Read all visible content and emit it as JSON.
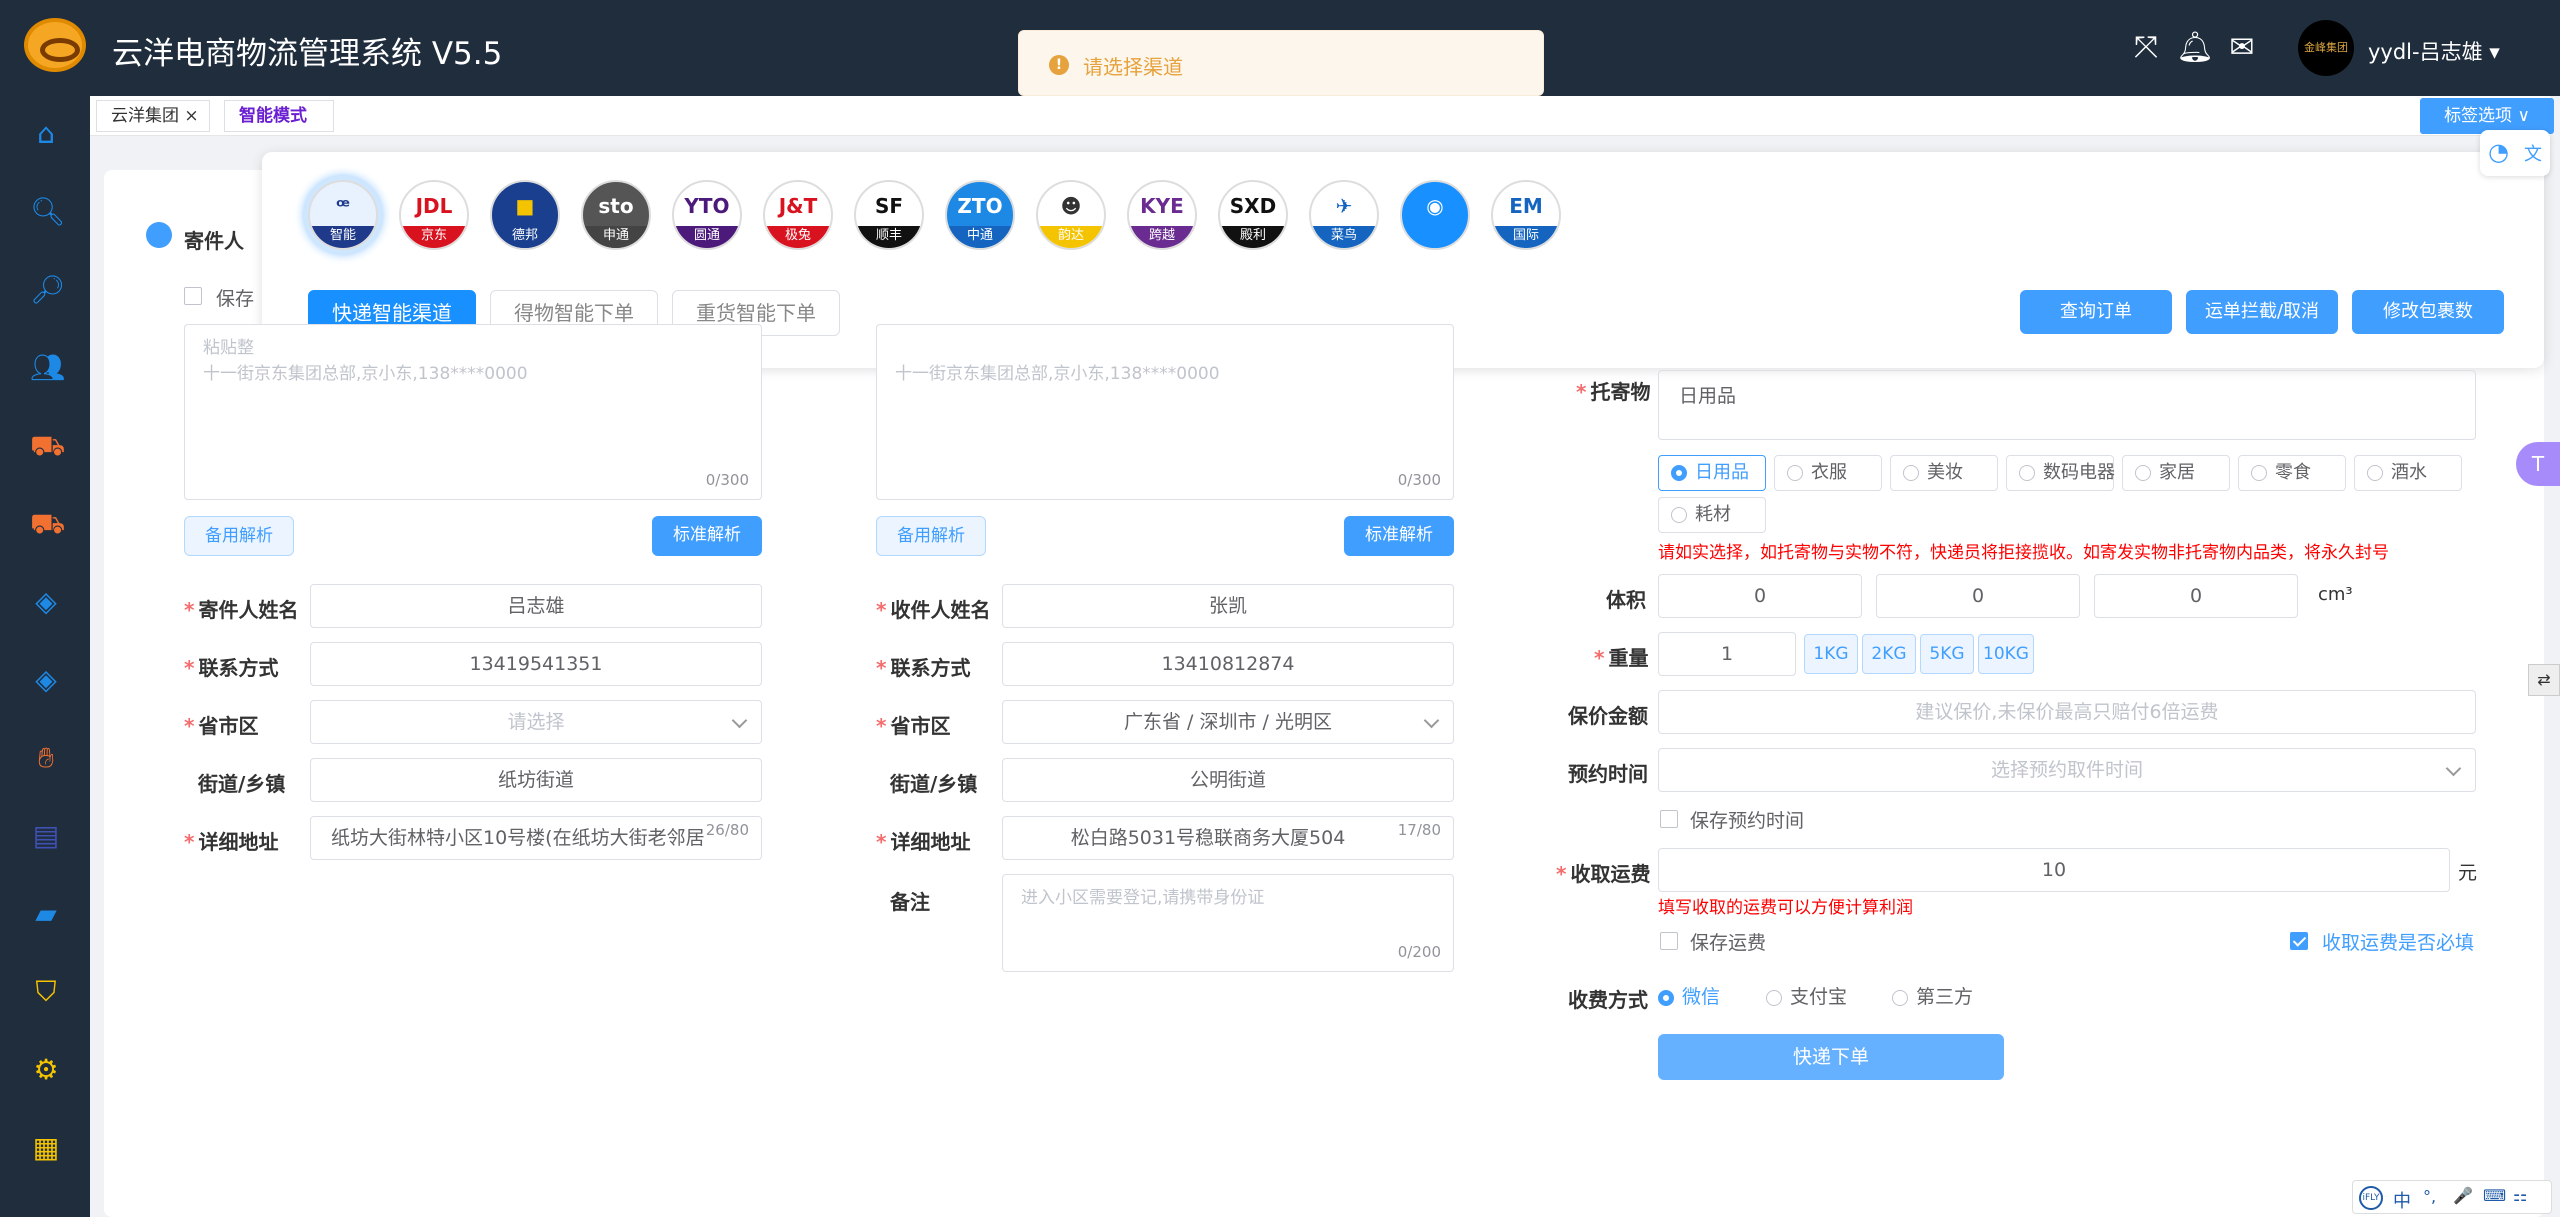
{
  "app": {
    "title": "云洋电商物流管理系统 V5.5",
    "username": "yydl-吕志雄",
    "avatar_text": "金峰集团"
  },
  "toast": {
    "message": "请选择渠道"
  },
  "tabs": [
    {
      "label": "云洋集团",
      "close": "×"
    },
    {
      "label": "智能模式"
    }
  ],
  "tag_select": {
    "label": "标签选项 ∨"
  },
  "channels": [
    {
      "name": "智能",
      "logo": "ꟹ",
      "bg": "#e8f2ff",
      "band": "#1f3a8a",
      "fg": "#1f3a8a"
    },
    {
      "name": "京东",
      "logo": "JDL",
      "bg": "#fff",
      "band": "#d8121f",
      "fg": "#d8121f"
    },
    {
      "name": "德邦",
      "logo": "■",
      "bg": "#1a3f8f",
      "band": "#1a3f8f",
      "fg": "#f5c400"
    },
    {
      "name": "申通",
      "logo": "sto",
      "bg": "#555",
      "band": "#444",
      "fg": "#fff"
    },
    {
      "name": "圆通",
      "logo": "YTO",
      "bg": "#fff",
      "band": "#4b1a7a",
      "fg": "#4b1a7a"
    },
    {
      "name": "极兔",
      "logo": "J&T",
      "bg": "#fff",
      "band": "#d8121f",
      "fg": "#d8121f"
    },
    {
      "name": "顺丰",
      "logo": "SF",
      "bg": "#fff",
      "band": "#111",
      "fg": "#111"
    },
    {
      "name": "中通",
      "logo": "ZTO",
      "bg": "#1e88e5",
      "band": "#1565c0",
      "fg": "#fff"
    },
    {
      "name": "韵达",
      "logo": "☻",
      "bg": "#fff",
      "band": "#f5c400",
      "fg": "#333"
    },
    {
      "name": "跨越",
      "logo": "KYE",
      "bg": "#fff",
      "band": "#6b2c91",
      "fg": "#6b2c91"
    },
    {
      "name": "殿利",
      "logo": "SXD",
      "bg": "#fff",
      "band": "#111",
      "fg": "#111"
    },
    {
      "name": "菜鸟",
      "logo": "✈",
      "bg": "#fff",
      "band": "#1565c0",
      "fg": "#1565c0"
    },
    {
      "name": "",
      "logo": "◉",
      "bg": "#1890ff",
      "band": "#1890ff",
      "fg": "#fff"
    },
    {
      "name": "国际",
      "logo": "EM",
      "bg": "#fff",
      "band": "#1565c0",
      "fg": "#1565c0"
    }
  ],
  "modes": [
    "快递智能渠道",
    "得物智能下单",
    "重货智能下单"
  ],
  "actions": [
    "查询订单",
    "运单拦截/取消",
    "修改包裹数"
  ],
  "sender": {
    "section_title": "寄件人",
    "save_label": "保存",
    "paste_placeholder_1": "粘贴整",
    "paste_placeholder_2": "十一街京东集团总部,京小东,138****0000",
    "counter": "0/300",
    "backup_parse": "备用解析",
    "standard_parse": "标准解析",
    "name_label": "寄件人姓名",
    "name_value": "吕志雄",
    "phone_label": "联系方式",
    "phone_value": "13419541351",
    "region_label": "省市区",
    "region_placeholder": "请选择",
    "street_label": "街道/乡镇",
    "street_value": "纸坊街道",
    "address_label": "详细地址",
    "address_value": "纸坊大街林特小区10号楼(在纸坊大街老邻居",
    "address_counter": "26/80"
  },
  "receiver": {
    "paste_placeholder": "十一街京东集团总部,京小东,138****0000",
    "counter": "0/300",
    "backup_parse": "备用解析",
    "standard_parse": "标准解析",
    "name_label": "收件人姓名",
    "name_value": "张凯",
    "phone_label": "联系方式",
    "phone_value": "13410812874",
    "region_label": "省市区",
    "region_value": "广东省 / 深圳市 / 光明区",
    "street_label": "街道/乡镇",
    "street_value": "公明街道",
    "address_label": "详细地址",
    "address_value": "松白路5031号稳联商务大厦504",
    "address_counter": "17/80",
    "remark_label": "备注",
    "remark_placeholder": "进入小区需要登记,请携带身份证",
    "remark_counter": "0/200"
  },
  "goods": {
    "label": "托寄物",
    "value": "日用品",
    "categories": [
      "日用品",
      "衣服",
      "美妆",
      "数码电器",
      "家居",
      "零食",
      "酒水",
      "耗材"
    ],
    "selected": "日用品",
    "warning": "请如实选择，如托寄物与实物不符，快递员将拒接揽收。如寄发实物非托寄物内品类，将永久封号",
    "volume_label": "体积",
    "volume": [
      "0",
      "0",
      "0"
    ],
    "volume_unit": "cm³",
    "weight_label": "重量",
    "weight": "1",
    "weight_tags": [
      "1KG",
      "2KG",
      "5KG",
      "10KG"
    ],
    "insure_label": "保价金额",
    "insure_placeholder": "建议保价,未保价最高只赔付6倍运费",
    "appoint_label": "预约时间",
    "appoint_placeholder": "选择预约取件时间",
    "save_appoint": "保存预约时间",
    "fee_label": "收取运费",
    "fee_value": "10",
    "fee_unit": "元",
    "fee_tip": "填写收取的运费可以方便计算利润",
    "save_fee": "保存运费",
    "fee_required": "收取运费是否必填",
    "pay_label": "收费方式",
    "pay_options": [
      "微信",
      "支付宝",
      "第三方"
    ],
    "pay_selected": "微信",
    "submit": "快递下单"
  },
  "ime": [
    "中",
    "°,",
    "🎤",
    "⌨",
    "⚏"
  ]
}
